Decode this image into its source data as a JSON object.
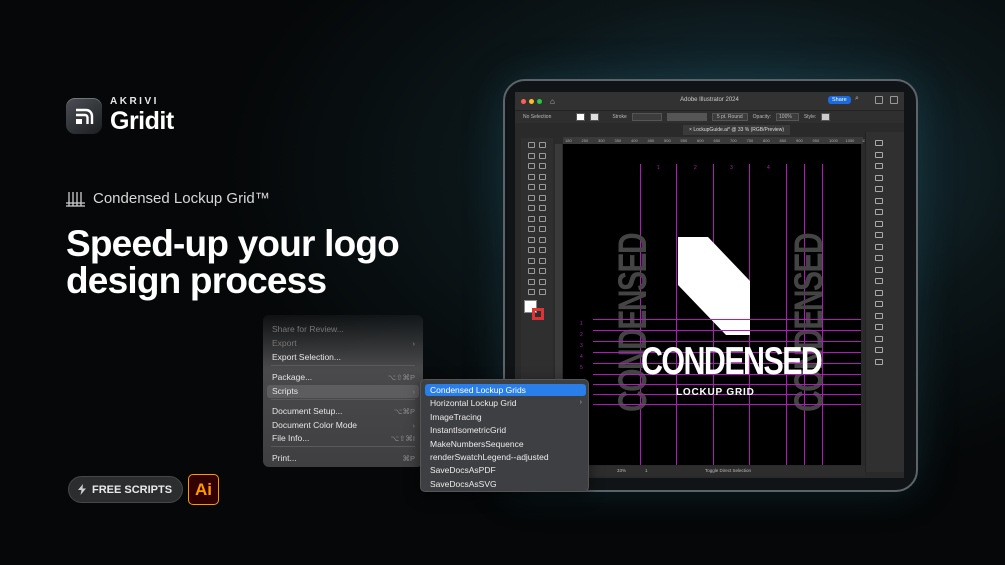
{
  "brand": {
    "top": "AKRIVI",
    "main": "Gridit"
  },
  "product": {
    "name": "Condensed Lockup Grid™",
    "icon": "grid-lines-icon"
  },
  "headline": "Speed-up your logo design process",
  "badges": {
    "free_scripts": "FREE SCRIPTS",
    "ai": "Ai"
  },
  "colors": {
    "accent_blue": "#2a7ee8",
    "guide": "#b01ab8",
    "ai_orange": "#ff9a00",
    "background": "#0b1518"
  },
  "illustrator": {
    "title": "Adobe Illustrator 2024",
    "share": "Share",
    "control": {
      "selection": "No Selection",
      "stroke": "Stroke",
      "brush": "5 pt. Round",
      "opacity_label": "Opacity:",
      "opacity": "100%",
      "style": "Style:"
    },
    "doc_tab": "LockupGuide.ai* @ 33 % (RGB/Preview)",
    "ruler": [
      "180",
      "250",
      "300",
      "350",
      "400",
      "450",
      "500",
      "550",
      "600",
      "650",
      "700",
      "750",
      "800",
      "850",
      "900",
      "950",
      "1000",
      "1050",
      "1100"
    ],
    "columns": [
      "1",
      "2",
      "3",
      "4"
    ],
    "rows": [
      "1",
      "2",
      "3",
      "4",
      "5"
    ],
    "ghost_word": "CONDENSED",
    "logo_word": "CONDENSED",
    "logo_sub": "LOCKUP GRID",
    "status": {
      "zoom": "33%",
      "page": "1",
      "mode": "Toggle Direct Selection"
    }
  },
  "file_menu": {
    "items": [
      {
        "label": "Share for Review...",
        "shortcut": "",
        "state": "dim"
      },
      {
        "label": "Export",
        "shortcut": "›",
        "state": "dim"
      },
      {
        "label": "Export Selection...",
        "shortcut": "",
        "state": "normal"
      },
      {
        "label": "Package...",
        "shortcut": "⌥⇧⌘P",
        "state": "normal"
      },
      {
        "label": "Scripts",
        "shortcut": "›",
        "state": "highlight"
      },
      {
        "label": "Document Setup...",
        "shortcut": "⌥⌘P",
        "state": "normal"
      },
      {
        "label": "Document Color Mode",
        "shortcut": "›",
        "state": "normal"
      },
      {
        "label": "File Info...",
        "shortcut": "⌥⇧⌘I",
        "state": "normal"
      },
      {
        "label": "Print...",
        "shortcut": "⌘P",
        "state": "normal"
      }
    ]
  },
  "scripts_menu": {
    "items": [
      {
        "label": "Condensed Lockup Grids",
        "active": true,
        "submenu": false
      },
      {
        "label": "Horizontal Lockup Grid",
        "active": false,
        "submenu": true
      },
      {
        "label": "ImageTracing",
        "active": false,
        "submenu": false
      },
      {
        "label": "InstantIsometricGrid",
        "active": false,
        "submenu": false
      },
      {
        "label": "MakeNumbersSequence",
        "active": false,
        "submenu": false
      },
      {
        "label": "renderSwatchLegend--adjusted",
        "active": false,
        "submenu": false
      },
      {
        "label": "SaveDocsAsPDF",
        "active": false,
        "submenu": false
      },
      {
        "label": "SaveDocsAsSVG",
        "active": false,
        "submenu": false
      }
    ]
  }
}
